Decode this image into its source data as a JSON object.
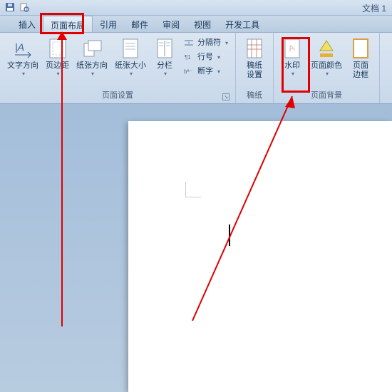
{
  "title": "文档 1",
  "tabs": {
    "insert": "插入",
    "layout": "页面布局",
    "references": "引用",
    "mailings": "邮件",
    "review": "审阅",
    "view": "视图",
    "developer": "开发工具"
  },
  "ribbon": {
    "page_setup": {
      "text_direction": "文字方向",
      "margins": "页边距",
      "orientation": "纸张方向",
      "size": "纸张大小",
      "columns": "分栏",
      "breaks": "分隔符",
      "line_numbers": "行号",
      "hyphenation": "断字",
      "group_label": "页面设置"
    },
    "manuscript": {
      "settings": "稿纸\n设置",
      "group_label": "稿纸"
    },
    "background": {
      "watermark": "水印",
      "page_color": "页面颜色",
      "page_border": "页面\n边框",
      "group_label": "页面背景"
    }
  }
}
